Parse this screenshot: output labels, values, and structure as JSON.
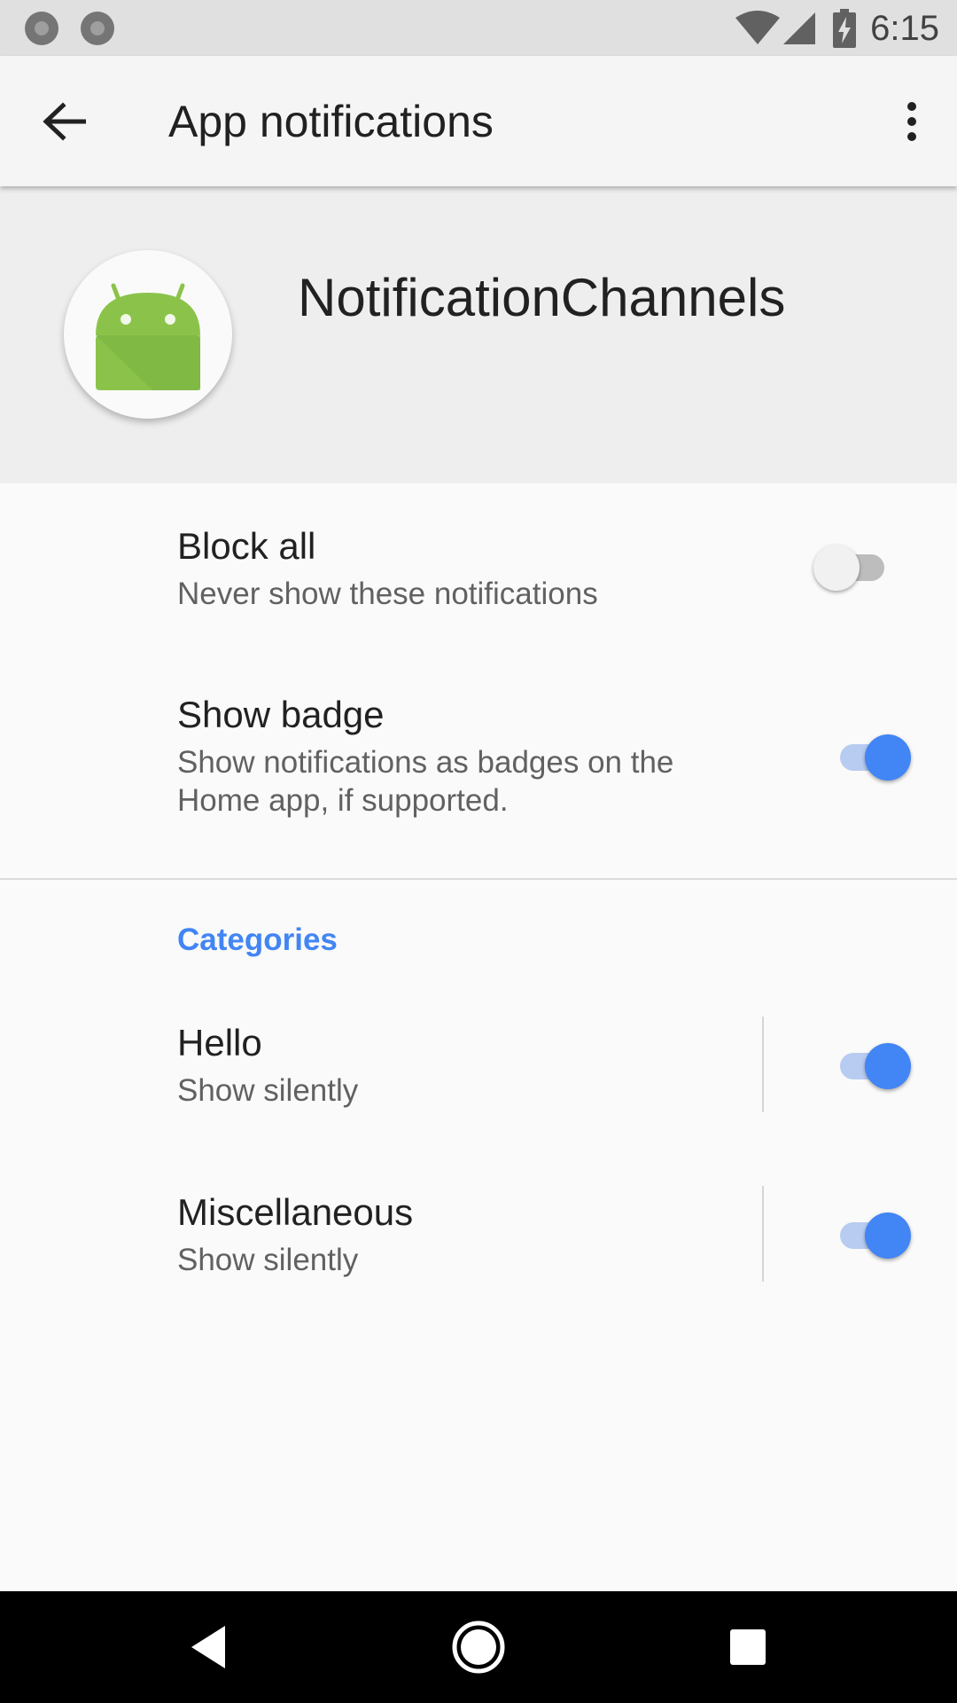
{
  "status_bar": {
    "time": "6:15",
    "icons": [
      "notification-dot-icon",
      "notification-dot-icon",
      "wifi-icon",
      "cell-signal-icon",
      "battery-charging-icon"
    ]
  },
  "toolbar": {
    "back_icon": "arrow-back-icon",
    "title": "App notifications",
    "overflow_icon": "more-vert-icon"
  },
  "app_header": {
    "icon": "android-robot-icon",
    "app_name": "NotificationChannels"
  },
  "settings": {
    "block_all": {
      "title": "Block all",
      "summary": "Never show these notifications",
      "enabled": false
    },
    "show_badge": {
      "title": "Show badge",
      "summary": "Show notifications as badges on the Home app, if supported.",
      "enabled": true
    }
  },
  "categories": {
    "header": "Categories",
    "items": [
      {
        "title": "Hello",
        "summary": "Show silently",
        "enabled": true
      },
      {
        "title": "Miscellaneous",
        "summary": "Show silently",
        "enabled": true
      }
    ]
  },
  "nav_bar": {
    "buttons": [
      "back-triangle-icon",
      "home-circle-icon",
      "recents-square-icon"
    ]
  },
  "colors": {
    "accent": "#4285f4",
    "android_green": "#8bc34a",
    "status_bar": "#e0e0e0",
    "toolbar": "#f5f5f5",
    "header_bg": "#eeeeee"
  }
}
